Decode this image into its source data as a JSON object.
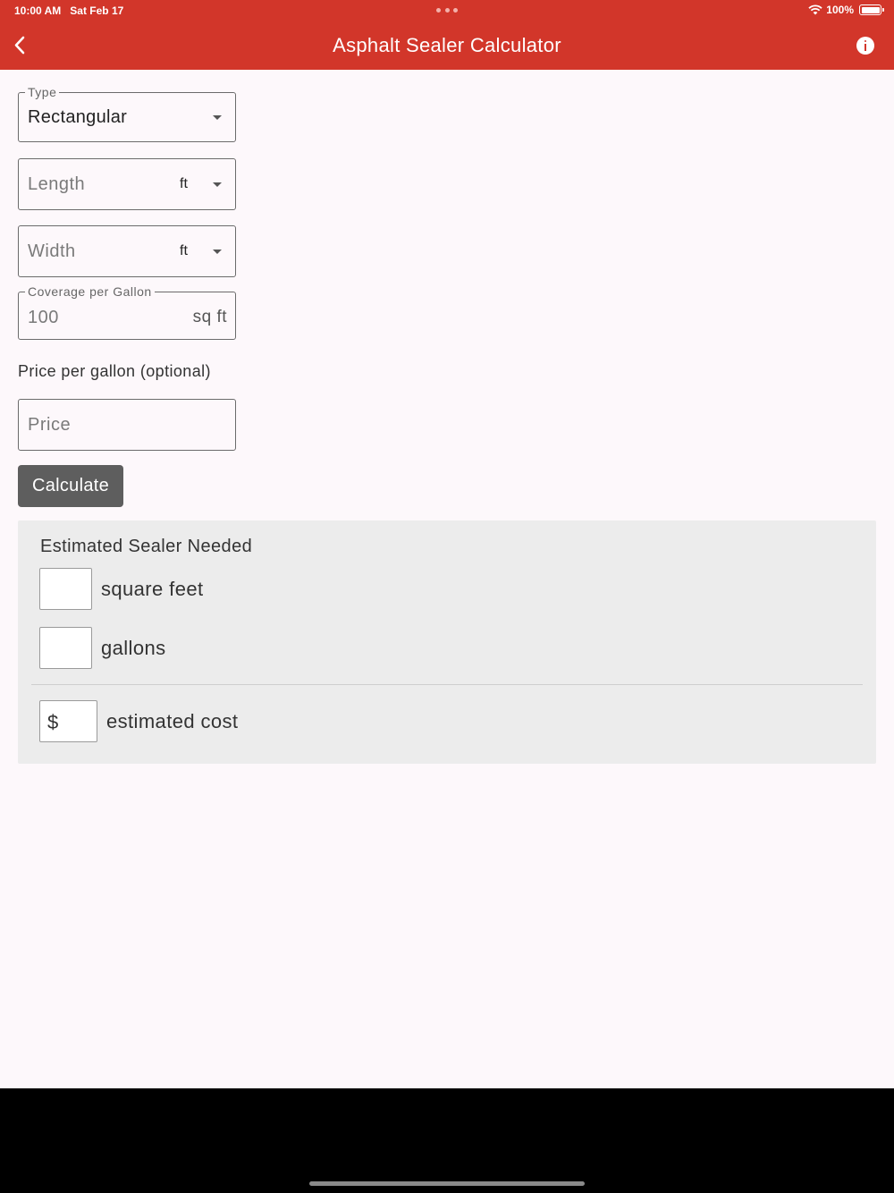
{
  "status_bar": {
    "time": "10:00 AM",
    "date": "Sat Feb 17",
    "battery": "100%"
  },
  "header": {
    "title": "Asphalt Sealer Calculator",
    "back_icon": "chevron-left-icon",
    "info_icon": "info-circle-icon",
    "color": "#d2362a"
  },
  "form": {
    "type": {
      "label": "Type",
      "value": "Rectangular"
    },
    "length": {
      "placeholder": "Length",
      "unit": "ft"
    },
    "width": {
      "placeholder": "Width",
      "unit": "ft"
    },
    "coverage": {
      "label": "Coverage per Gallon",
      "value": "100",
      "unit": "sq ft"
    },
    "price_label": "Price per gallon (optional)",
    "price": {
      "placeholder": "Price"
    },
    "calculate_label": "Calculate"
  },
  "results": {
    "title": "Estimated Sealer Needed",
    "square_feet_label": "square feet",
    "gallons_label": "gallons",
    "currency_symbol": "$",
    "cost_label": "estimated cost"
  }
}
